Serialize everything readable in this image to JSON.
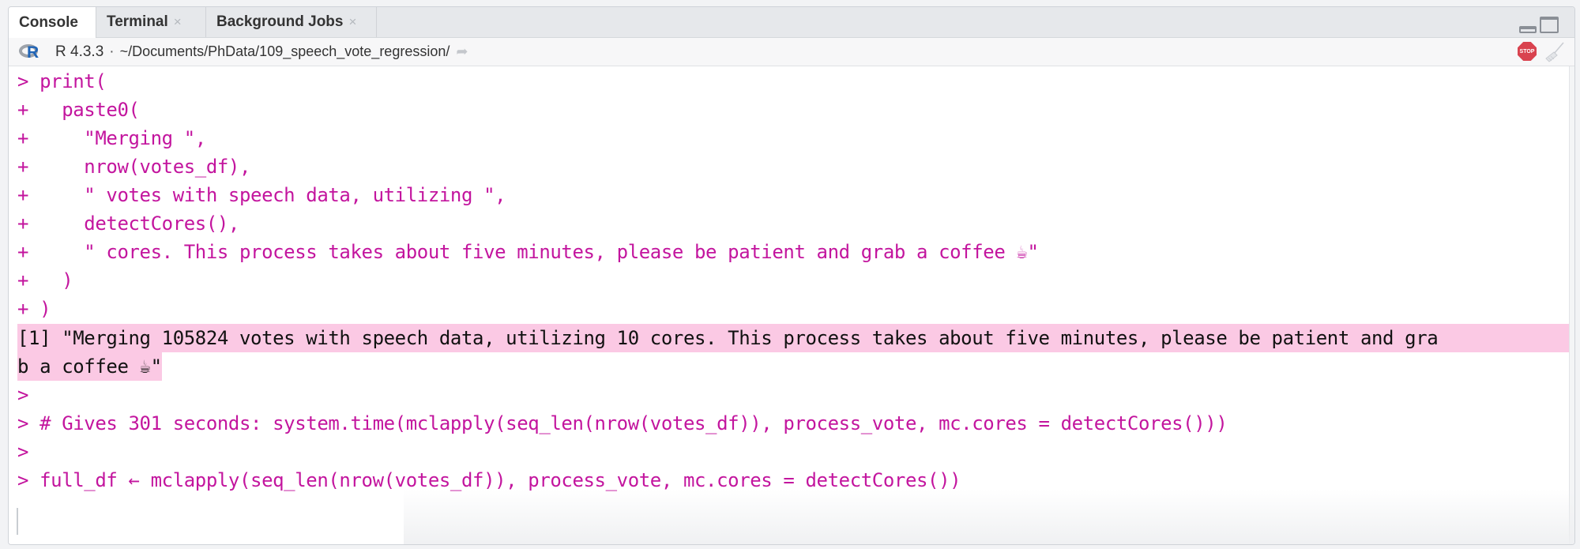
{
  "tabs": [
    {
      "label": "Console",
      "active": true,
      "closable": false
    },
    {
      "label": "Terminal",
      "active": false,
      "closable": true
    },
    {
      "label": "Background Jobs",
      "active": false,
      "closable": true
    }
  ],
  "close_glyph": "×",
  "window_controls": {
    "minimize_icon": "minimize-pane-icon",
    "maximize_icon": "maximize-pane-icon"
  },
  "infobar": {
    "r_logo": "R",
    "r_version": "R 4.3.3",
    "separator": "·",
    "working_dir": "~/Documents/PhData/109_speech_vote_regression/",
    "goto_icon": "➦",
    "stop_label": "STOP",
    "clear_icon": "broom-icon"
  },
  "console": {
    "colors": {
      "input": "#c3159e",
      "output": "#111111",
      "output_highlight": "#fbc9e4"
    },
    "lines": [
      "> print(",
      "+   paste0(",
      "+     \"Merging \",",
      "+     nrow(votes_df),",
      "+     \" votes with speech data, utilizing \",",
      "+     detectCores(),",
      "+     \" cores. This process takes about five minutes, please be patient and grab a coffee ☕\"",
      "+   )",
      "+ )"
    ],
    "output_lines": [
      "[1] \"Merging 105824 votes with speech data, utilizing 10 cores. This process takes about five minutes, please be patient and gra",
      "b a coffee ☕\""
    ],
    "after_lines": [
      ">",
      "> # Gives 301 seconds: system.time(mclapply(seq_len(nrow(votes_df)), process_vote, mc.cores = detectCores()))",
      ">",
      "> full_df ← mclapply(seq_len(nrow(votes_df)), process_vote, mc.cores = detectCores())"
    ]
  }
}
